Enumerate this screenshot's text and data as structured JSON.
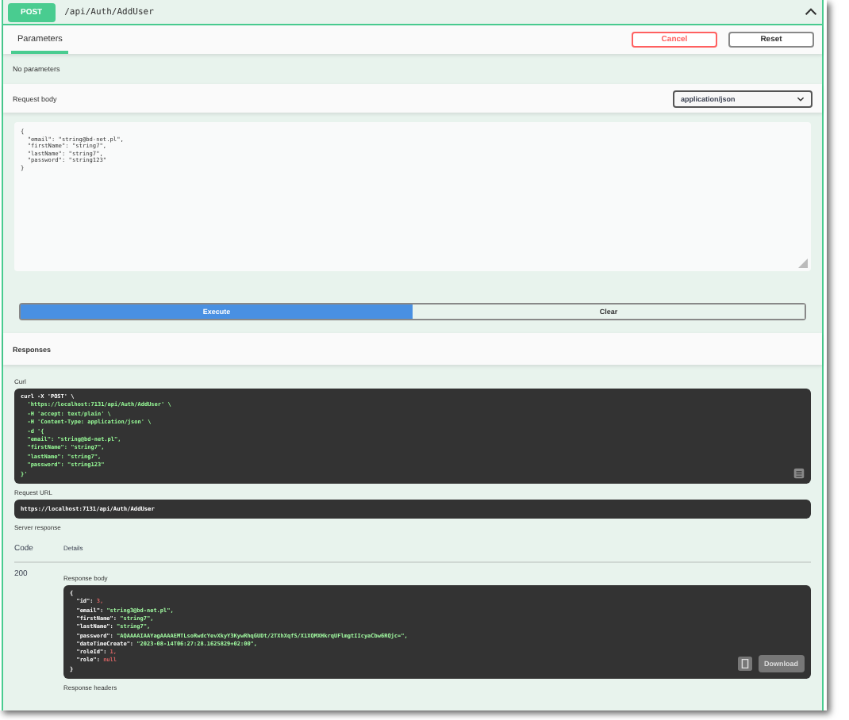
{
  "operation": {
    "method": "POST",
    "path": "/api/Auth/AddUser",
    "expanded": true
  },
  "parameters": {
    "tab": {
      "label": "Parameters",
      "selected": true
    },
    "buttons": [
      {
        "label": "Cancel",
        "kind": "cancel"
      },
      {
        "label": "Reset",
        "kind": "plain"
      }
    ],
    "empty_text": "No parameters"
  },
  "request_body": {
    "label": "Request body",
    "content_type": "application/json",
    "lines": [
      "{",
      "  \"email\": \"string@bd-net.pl\",",
      "  \"firstName\": \"string7\",",
      "  \"lastName\": \"string7\",",
      "  \"password\": \"string123\"",
      "}"
    ]
  },
  "actions": [
    {
      "label": "Execute",
      "kind": "primary"
    },
    {
      "label": "Clear",
      "kind": "plain"
    }
  ],
  "responses": {
    "title": "Responses",
    "curl_label": "Curl",
    "curl_lines": [
      "curl -X 'POST' \\",
      "  'https://localhost:7131/api/Auth/AddUser' \\",
      "  -H 'accept: text/plain' \\",
      "  -H 'Content-Type: application/json' \\",
      "  -d '{",
      "  \"email\": \"string@bd-net.pl\",",
      "  \"firstName\": \"string7\",",
      "  \"lastName\": \"string7\",",
      "  \"password\": \"string123\"",
      "}'"
    ],
    "request_url_label": "Request URL",
    "request_url": "https://localhost:7131/api/Auth/AddUser",
    "server_response_label": "Server response",
    "code_header": "Code",
    "details_header": "Details",
    "code": "200",
    "response_body_label": "Response body",
    "body_lines": [
      {
        "key": "{"
      },
      {
        "key": "  \"id\": ",
        "value": "3,"
      },
      {
        "key": "  \"email\": ",
        "value": "\"string3@bd-net.pl\","
      },
      {
        "key": "  \"firstName\": ",
        "value": "\"string7\","
      },
      {
        "key": "  \"lastName\": ",
        "value": "\"string7\","
      },
      {
        "key": "  \"password\": ",
        "value": "\"AQAAAAIAAYagAAAAEMTLsoRwdcYevXkyY3KywRhqGUDt/2TXhXqfS/X1XQMXHkrqUFlmgtIIcyaCbw6RQjc=\","
      },
      {
        "key": "  \"dateTimeCreate\": ",
        "value": "\"2023-08-14T06:27:28.1625829+02:00\","
      },
      {
        "key": "  \"roleId\": ",
        "value": "1,"
      },
      {
        "key": "  \"role\": ",
        "value": "null"
      },
      {
        "key": "}"
      }
    ],
    "download_label": "Download",
    "response_headers_label": "Response headers"
  }
}
